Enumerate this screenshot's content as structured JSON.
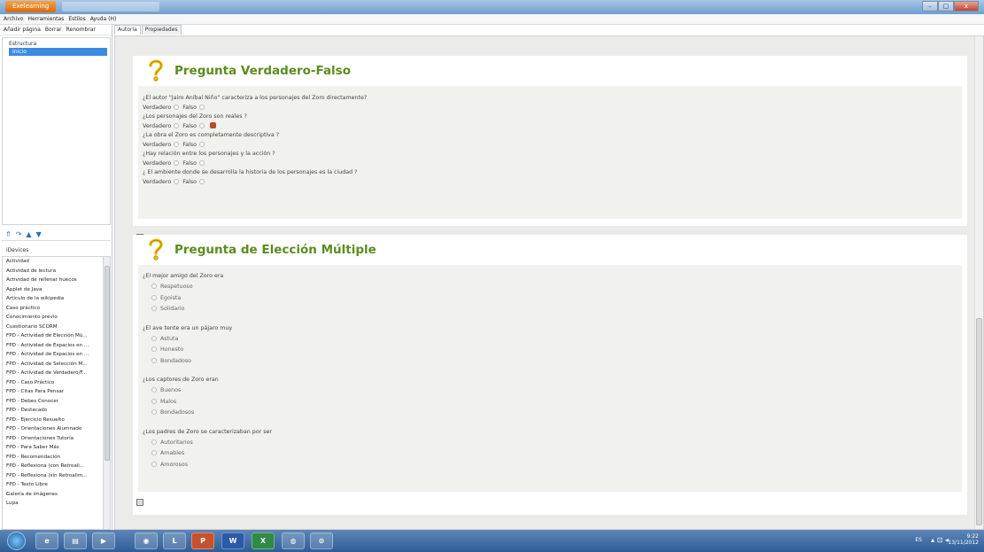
{
  "titlebar": {
    "app_button": "Exelearning"
  },
  "window_controls": {
    "minimize": "–",
    "maximize": "▢",
    "close": "x"
  },
  "menubar": [
    "Archivo",
    "Herramientas",
    "Estilos",
    "Ayuda (H)"
  ],
  "left_toolbar": [
    "Añadir página",
    "Borrar",
    "Renombrar"
  ],
  "outline": {
    "heading": "Estructura",
    "items": [
      "Inicio"
    ]
  },
  "left_icons": [
    "⇑",
    "↷",
    "▲",
    "▼"
  ],
  "idevices": {
    "heading": "iDevices",
    "items": [
      "Actividad",
      "Actividad de lectura",
      "Actividad de rellenar huecos",
      "Applet de Java",
      "Artículo de la wikipedia",
      "Caso práctico",
      "Conocimiento previo",
      "Cuestionario SCORM",
      "FPD - Actividad de Elección Mú...",
      "FPD - Actividad de Espacios en ...",
      "FPD - Actividad de Espacios en ...",
      "FPD - Actividad de Selección M...",
      "FPD - Actividad de Verdadero/F...",
      "FPD - Caso Práctico",
      "FPD - Citas Para Pensar",
      "FPD - Debes Conocer",
      "FPD - Destacado",
      "FPD - Ejercicio Resuelto",
      "FPD - Orientaciones Alumnado",
      "FPD - Orientaciones Tutoría",
      "FPD - Para Saber Más",
      "FPD - Recomendación",
      "FPD - Reflexiona (con Retroali...",
      "FPD - Reflexiona (sin Retroalim...",
      "FPD - Texto Libre",
      "Galería de imágenes",
      "Lupa"
    ]
  },
  "tabs": [
    "Autoría",
    "Propiedades"
  ],
  "tf_card": {
    "title": "Pregunta Verdadero-Falso",
    "true_label": "Verdadero",
    "false_label": "Falso",
    "questions": [
      "¿El autor \"Jairo Aníbal Niño\" caracteriza a los personajes del Zoro directamente?",
      "¿Los personajes del Zoro son reales ?",
      "¿La obra el Zoro es completamente descriptiva ?",
      "¿Hay relación entre los personajes y la acción ?",
      "¿ El ambiente donde se desarrolla la historia de los personajes es la ciudad ?"
    ]
  },
  "mc_card": {
    "title": "Pregunta de Elección Múltiple",
    "questions": [
      {
        "q": "¿El mejor amigo del Zoro era",
        "options": [
          "Respetuoso",
          "Egoista",
          "Solidario"
        ]
      },
      {
        "q": "¿El ave tente era un pájaro muy",
        "options": [
          "Astuta",
          "Honesto",
          "Bondadoso"
        ]
      },
      {
        "q": "¿Los captores de Zoro eran",
        "options": [
          "Buenos",
          "Malos",
          "Bondadosos"
        ]
      },
      {
        "q": "¿Los padres de Zoro se caracterizaban por ser",
        "options": [
          "Autoritarios",
          "Amables",
          "Amorosos"
        ]
      }
    ]
  },
  "taskbar": {
    "apps": [
      "e",
      "▤",
      "▶",
      "◉",
      "L",
      "P",
      "W",
      "X",
      "◍",
      "⊙"
    ],
    "lang": "ES",
    "tray_icons": "▴ ⊡ ◂",
    "time": "9:22",
    "date": "13/11/2012"
  },
  "colors": {
    "title_green": "#5b8c1f",
    "selection_blue": "#3b8ce0",
    "content_bg": "#ebebea"
  }
}
